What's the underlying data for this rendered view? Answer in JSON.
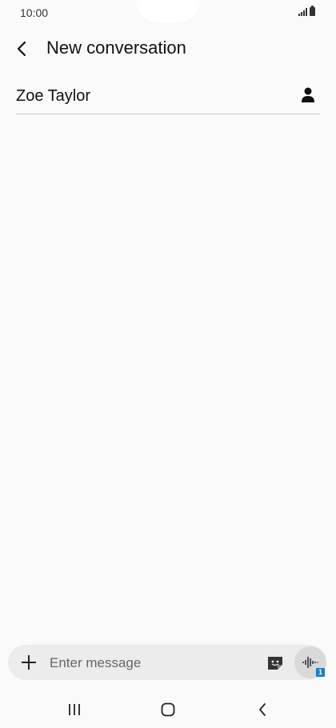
{
  "status_bar": {
    "time": "10:00",
    "icons": [
      "signal-icon",
      "battery-icon"
    ]
  },
  "header": {
    "back_icon": "chevron-left-icon",
    "title": "New conversation"
  },
  "recipient": {
    "name": "Zoe Taylor",
    "contact_icon": "person-icon"
  },
  "composer": {
    "attach_icon": "plus-icon",
    "placeholder": "Enter message",
    "sticker_icon": "sticker-icon",
    "voice_icon": "voice-wave-icon",
    "sim_badge": "1"
  },
  "navigation": {
    "recents_icon": "recents-icon",
    "home_icon": "home-icon",
    "back_icon": "nav-back-icon"
  },
  "colors": {
    "background": "#fafafa",
    "composer_bg": "#ececec",
    "voice_bg": "#d9d9d9",
    "sim_badge": "#1a7fc1"
  }
}
